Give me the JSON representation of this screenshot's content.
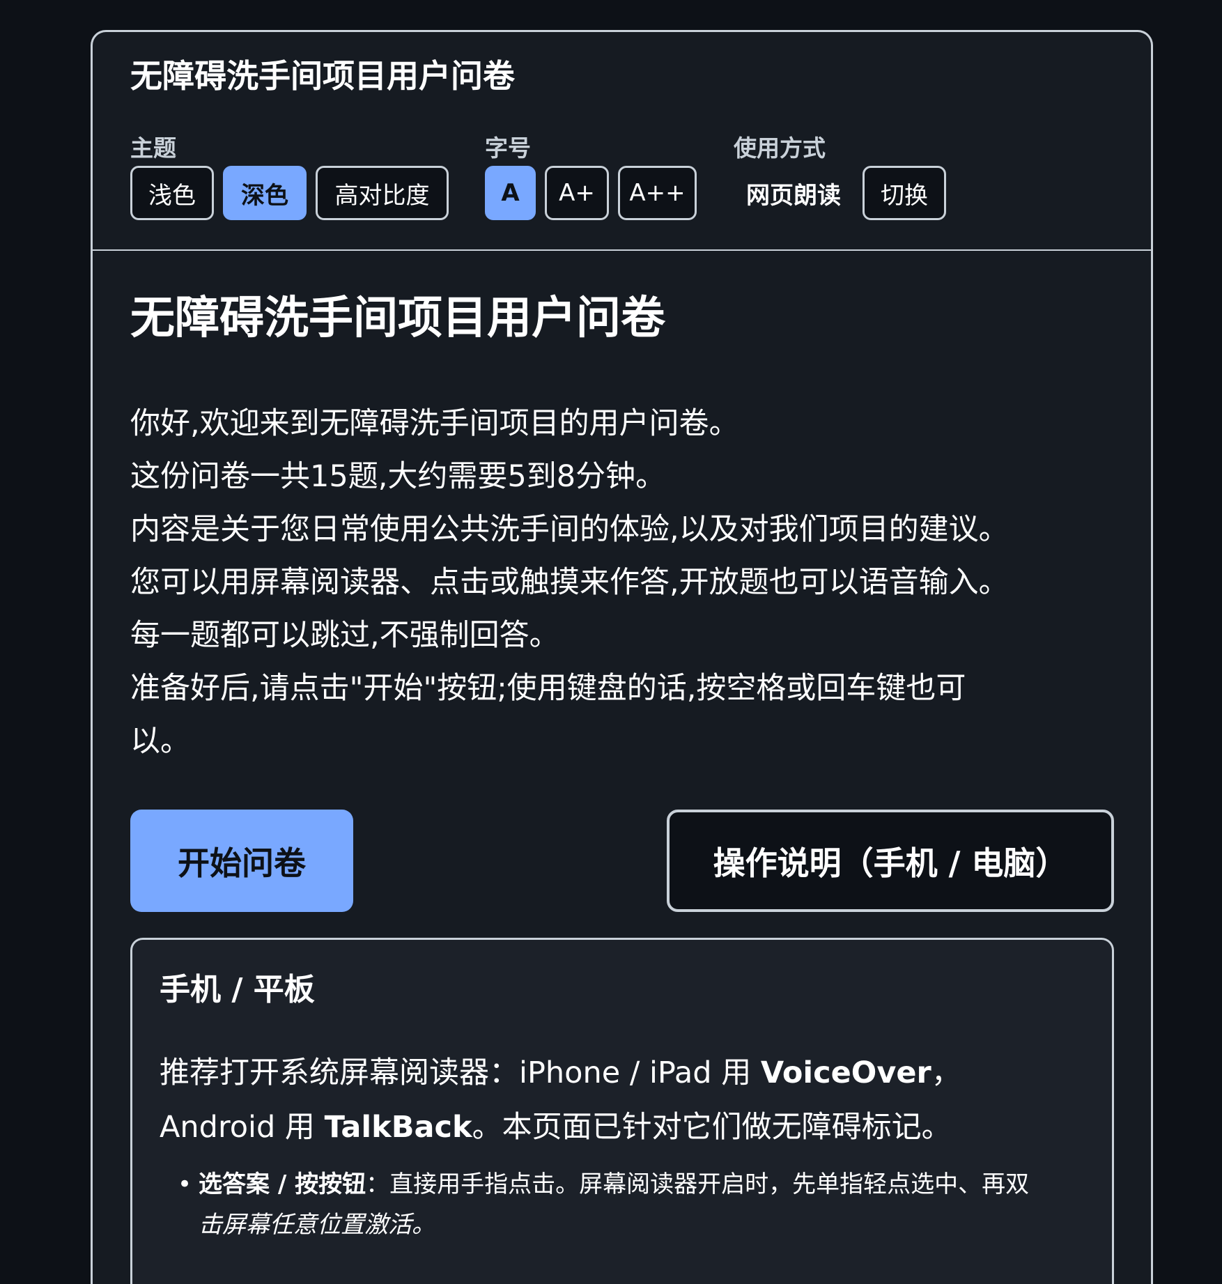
{
  "toolbar": {
    "title": "无障碍洗手间项目用户问卷",
    "theme": {
      "label": "主题",
      "options": [
        "浅色",
        "深色",
        "高对比度"
      ],
      "selected": "深色"
    },
    "font_size": {
      "label": "字号",
      "options": [
        "A",
        "A+",
        "A++"
      ],
      "selected": "A"
    },
    "usage": {
      "label": "使用方式",
      "current": "网页朗读",
      "toggle_label": "切换"
    }
  },
  "main": {
    "title": "无障碍洗手间项目用户问卷",
    "intro": [
      "你好,欢迎来到无障碍洗手间项目的用户问卷。",
      "这份问卷一共15题,大约需要5到8分钟。",
      "内容是关于您日常使用公共洗手间的体验,以及对我们项目的建议。",
      "您可以用屏幕阅读器、点击或触摸来作答,开放题也可以语音输入。",
      "每一题都可以跳过,不强制回答。",
      "准备好后,请点击\"开始\"按钮;使用键盘的话,按空格或回车键也可",
      "以。"
    ],
    "start_button": "开始问卷",
    "help_button": "操作说明（手机 / 电脑）"
  },
  "help": {
    "title": "手机 / 平板",
    "line1_prefix": "推荐打开系统屏幕阅读器：iPhone / iPad 用 ",
    "line1_strong": "VoiceOver",
    "line1_suffix": "，",
    "line2_prefix": "Android 用 ",
    "line2_strong": "TalkBack",
    "line2_suffix": "。本页面已针对它们做无障碍标记。",
    "items": [
      {
        "strong": "选答案 / 按按钮",
        "text_line1": "：直接用手指点击。屏幕阅读器开启时，先单指轻点选中、再双",
        "text_line2": "击屏幕任意位置激活。"
      }
    ]
  },
  "colors": {
    "background": "#0d1117",
    "card": "#161b22",
    "accent": "#79a8ff",
    "border": "#c9d1d9"
  }
}
